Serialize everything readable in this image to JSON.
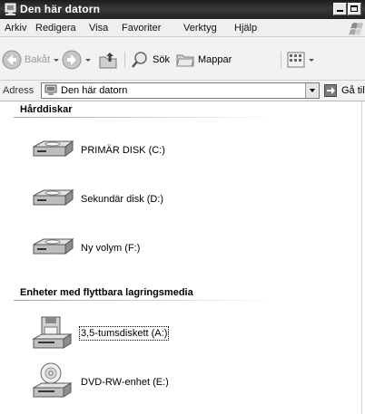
{
  "window": {
    "title": "Den här datorn"
  },
  "menubar": {
    "items": [
      "Arkiv",
      "Redigera",
      "Visa",
      "Favoriter",
      "Verktyg",
      "Hjälp"
    ]
  },
  "toolbar": {
    "back_label": "Bakåt",
    "search_label": "Sök",
    "folders_label": "Mappar"
  },
  "address": {
    "label": "Adress",
    "value": "Den här datorn",
    "go_label": "Gå till"
  },
  "groups": [
    {
      "title": "Hårddiskar",
      "items": [
        {
          "label": "PRIMÄR DISK (C:)",
          "icon": "hard-drive-icon"
        },
        {
          "label": "Sekundär disk (D:)",
          "icon": "hard-drive-icon"
        },
        {
          "label": "Ny volym (F:)",
          "icon": "hard-drive-icon"
        }
      ]
    },
    {
      "title": "Enheter med flyttbara lagringsmedia",
      "items": [
        {
          "label": "3,5-tumsdiskett (A:)",
          "icon": "floppy-drive-icon",
          "focused": true
        },
        {
          "label": "DVD-RW-enhet (E:)",
          "icon": "dvd-drive-icon"
        }
      ]
    }
  ]
}
